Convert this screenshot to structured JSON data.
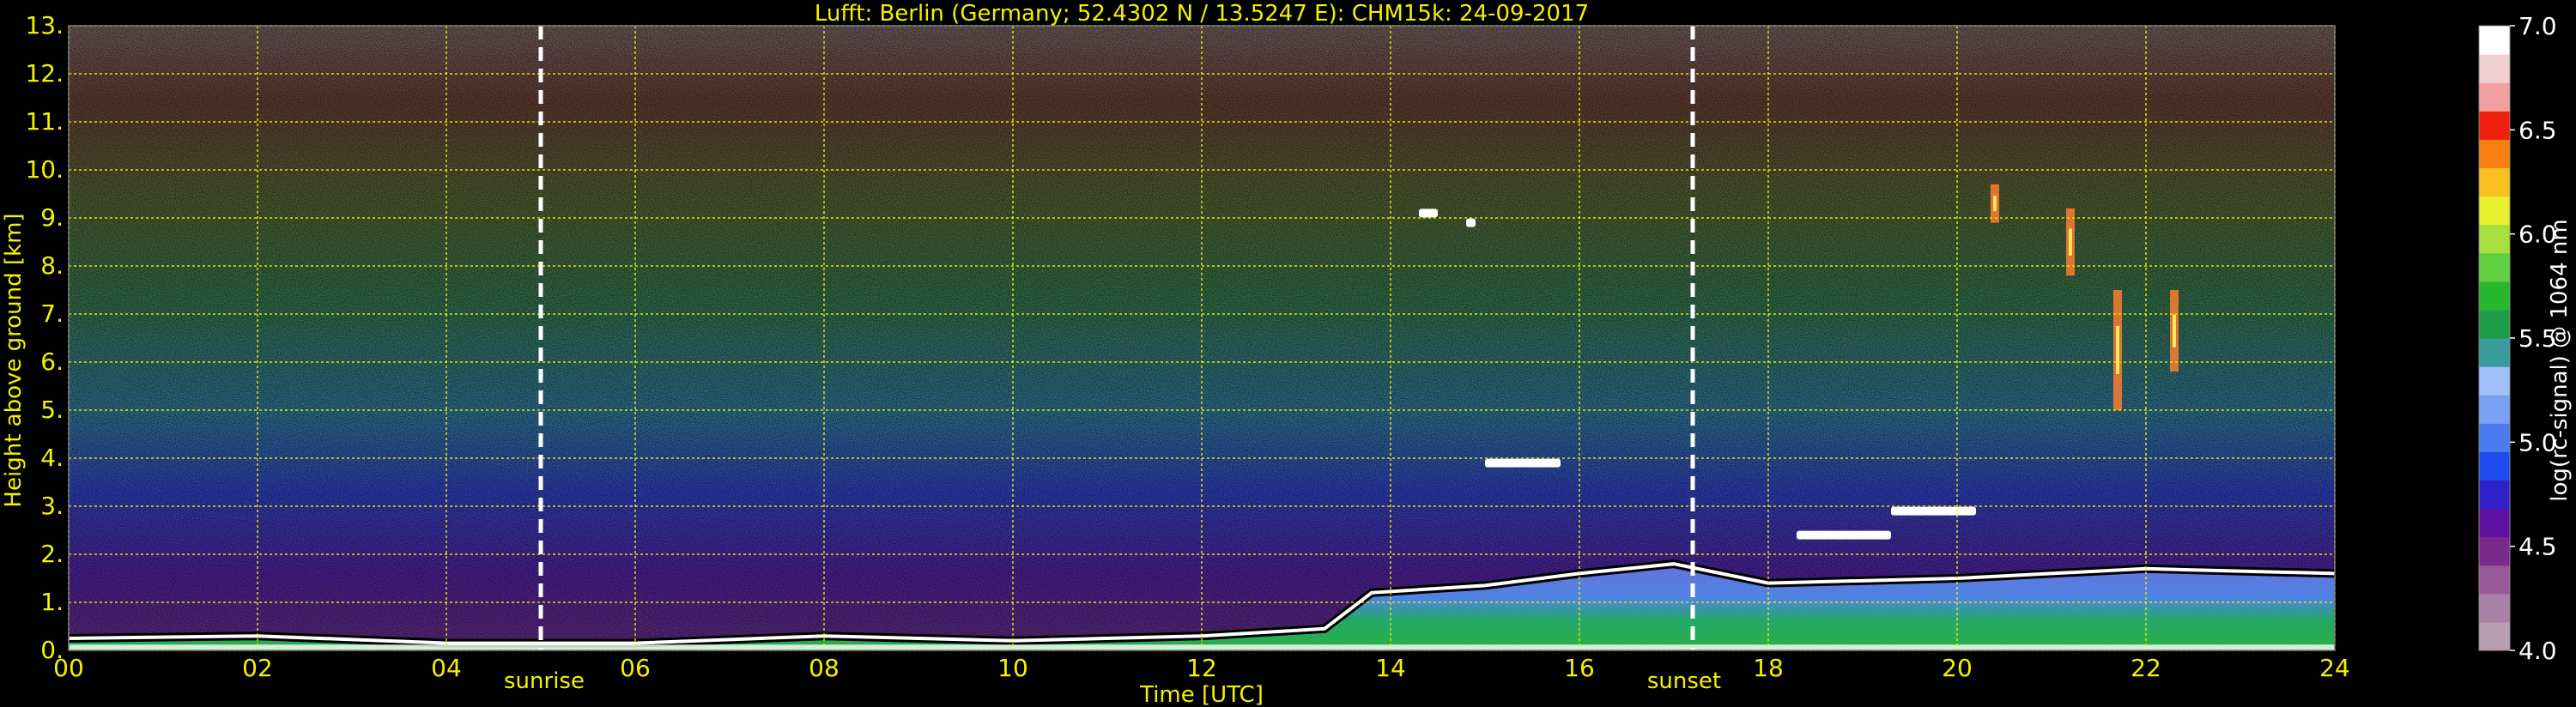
{
  "chart_data": {
    "type": "heatmap",
    "title": "Lufft: Berlin (Germany; 52.4302 N / 13.5247 E):    CHM15k: 24-09-2017",
    "xlabel": "Time [UTC]",
    "ylabel": "Height above ground [km]",
    "xlim": [
      0,
      24
    ],
    "ylim": [
      0,
      13
    ],
    "x_ticks": [
      "00",
      "02",
      "04",
      "06",
      "08",
      "10",
      "12",
      "14",
      "16",
      "18",
      "20",
      "22",
      "24"
    ],
    "y_ticks": [
      "0.",
      "1.",
      "2.",
      "3.",
      "4.",
      "5.",
      "6.",
      "7.",
      "8.",
      "9.",
      "10.",
      "11.",
      "12.",
      "13."
    ],
    "grid": true,
    "colorbar": {
      "label": "log(rc-signal) @ 1064 nm",
      "range": [
        4.0,
        7.0
      ],
      "ticks": [
        "4.0",
        "4.5",
        "5.0",
        "5.5",
        "6.0",
        "6.5",
        "7.0"
      ],
      "colors": [
        "#b8a0b0",
        "#a880a8",
        "#985898",
        "#7a2c8c",
        "#6010a0",
        "#3020c8",
        "#1f4cf0",
        "#4c7cf0",
        "#7aa0f4",
        "#a0c0f8",
        "#3a9c9c",
        "#1f9c48",
        "#28b830",
        "#60d040",
        "#a8e040",
        "#e8f030",
        "#f8c020",
        "#f88010",
        "#f02010",
        "#f0a0a0",
        "#f0d0d0",
        "#ffffff"
      ]
    },
    "annotations": [
      {
        "label": "sunrise",
        "time_utc": 5.0
      },
      {
        "label": "sunset",
        "time_utc": 17.2
      }
    ],
    "features": {
      "boundary_layer_top_km": [
        {
          "time": 0,
          "height": 0.25
        },
        {
          "time": 2,
          "height": 0.3
        },
        {
          "time": 4,
          "height": 0.15
        },
        {
          "time": 6,
          "height": 0.15
        },
        {
          "time": 8,
          "height": 0.3
        },
        {
          "time": 10,
          "height": 0.2
        },
        {
          "time": 12,
          "height": 0.3
        },
        {
          "time": 13.3,
          "height": 0.45
        },
        {
          "time": 13.8,
          "height": 1.2
        },
        {
          "time": 15,
          "height": 1.35
        },
        {
          "time": 16,
          "height": 1.6
        },
        {
          "time": 17,
          "height": 1.8
        },
        {
          "time": 18,
          "height": 1.4
        },
        {
          "time": 20,
          "height": 1.5
        },
        {
          "time": 22,
          "height": 1.7
        },
        {
          "time": 24,
          "height": 1.6
        }
      ],
      "cloud_layers": [
        {
          "start": 15.0,
          "end": 15.8,
          "height": 3.9
        },
        {
          "start": 18.3,
          "end": 19.3,
          "height": 2.4
        },
        {
          "start": 19.3,
          "end": 20.2,
          "height": 2.9
        },
        {
          "start": 14.3,
          "end": 14.5,
          "height": 9.1
        },
        {
          "start": 14.8,
          "end": 14.9,
          "height": 8.9
        }
      ],
      "cirrus_streaks": [
        {
          "time": 21.7,
          "top": 7.5,
          "bottom": 5.0
        },
        {
          "time": 22.3,
          "top": 7.5,
          "bottom": 5.8
        },
        {
          "time": 21.2,
          "top": 9.2,
          "bottom": 7.8
        },
        {
          "time": 20.4,
          "top": 9.7,
          "bottom": 8.9
        }
      ]
    }
  }
}
